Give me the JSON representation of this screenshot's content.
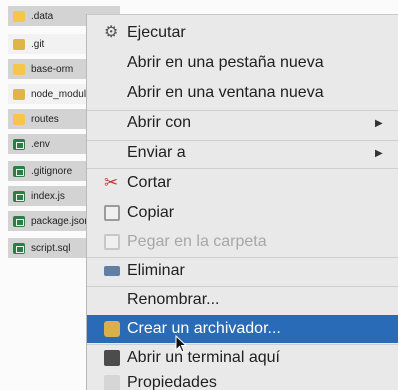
{
  "file_list": [
    {
      "name": ".data",
      "icon": "folder-icon"
    },
    {
      "name": ".git",
      "icon": "folder-icon"
    },
    {
      "name": "base-orm",
      "icon": "folder-icon"
    },
    {
      "name": "node_modul",
      "icon": "folder-icon"
    },
    {
      "name": "routes",
      "icon": "folder-icon"
    },
    {
      "name": ".env",
      "icon": "document-icon"
    },
    {
      "name": ".gitignore",
      "icon": "document-icon"
    },
    {
      "name": "index.js",
      "icon": "document-icon"
    },
    {
      "name": "package.json",
      "icon": "document-icon"
    },
    {
      "name": "script.sql",
      "icon": "document-icon"
    }
  ],
  "context_menu": {
    "items": [
      {
        "label": "Ejecutar",
        "icon": "execute-icon",
        "enabled": true
      },
      {
        "label": "Abrir en una pestaña nueva",
        "enabled": true
      },
      {
        "label": "Abrir en una ventana nueva",
        "enabled": true
      },
      {
        "label": "Abrir con",
        "has_submenu": true,
        "enabled": true
      },
      {
        "label": "Enviar a",
        "has_submenu": true,
        "enabled": true
      },
      {
        "label": "Cortar",
        "icon": "scissors-icon",
        "enabled": true
      },
      {
        "label": "Copiar",
        "icon": "copy-icon",
        "enabled": true
      },
      {
        "label": "Pegar en la carpeta",
        "icon": "paste-icon",
        "enabled": false
      },
      {
        "label": "Eliminar",
        "icon": "trash-icon",
        "enabled": true
      },
      {
        "label": "Renombrar...",
        "enabled": true
      },
      {
        "label": "Crear un archivador...",
        "icon": "archive-icon",
        "enabled": true,
        "highlighted": true
      },
      {
        "label": "Abrir un terminal aquí",
        "icon": "terminal-icon",
        "enabled": true
      },
      {
        "label": "Propiedades",
        "icon": "properties-icon",
        "enabled": true
      }
    ],
    "submenu_arrow": "▶",
    "execute_glyph": "⚙",
    "cut_glyph": "✂"
  },
  "colors": {
    "highlight": "#2a6bb8",
    "menu_background": "#e9e9e9",
    "file_row_background": "#d3d3d3"
  }
}
